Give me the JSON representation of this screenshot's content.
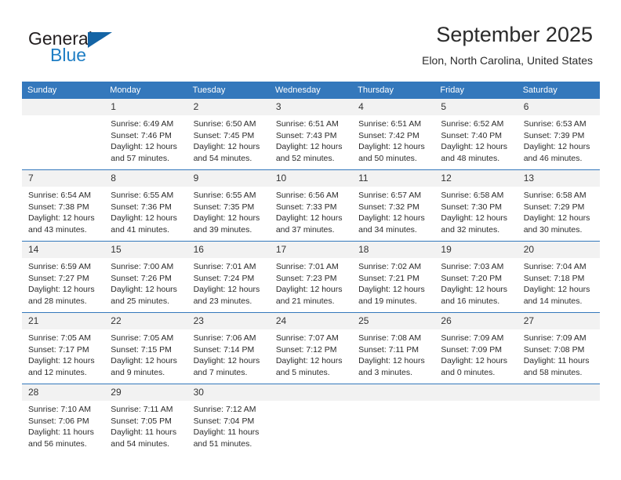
{
  "brand": {
    "name_part1": "General",
    "name_part2": "Blue",
    "triangle_color": "#1464a5",
    "blue_color": "#1f7ec4"
  },
  "header": {
    "month_title": "September 2025",
    "location": "Elon, North Carolina, United States",
    "header_bg_color": "#3478bc",
    "daynum_band_color": "#f2f2f2"
  },
  "calendar": {
    "weekday_headers": [
      "Sunday",
      "Monday",
      "Tuesday",
      "Wednesday",
      "Thursday",
      "Friday",
      "Saturday"
    ],
    "weeks": [
      [
        {
          "day": "",
          "sunrise": "",
          "sunset": "",
          "daylight_line1": "",
          "daylight_line2": "",
          "empty": true
        },
        {
          "day": "1",
          "sunrise": "Sunrise: 6:49 AM",
          "sunset": "Sunset: 7:46 PM",
          "daylight_line1": "Daylight: 12 hours",
          "daylight_line2": "and 57 minutes."
        },
        {
          "day": "2",
          "sunrise": "Sunrise: 6:50 AM",
          "sunset": "Sunset: 7:45 PM",
          "daylight_line1": "Daylight: 12 hours",
          "daylight_line2": "and 54 minutes."
        },
        {
          "day": "3",
          "sunrise": "Sunrise: 6:51 AM",
          "sunset": "Sunset: 7:43 PM",
          "daylight_line1": "Daylight: 12 hours",
          "daylight_line2": "and 52 minutes."
        },
        {
          "day": "4",
          "sunrise": "Sunrise: 6:51 AM",
          "sunset": "Sunset: 7:42 PM",
          "daylight_line1": "Daylight: 12 hours",
          "daylight_line2": "and 50 minutes."
        },
        {
          "day": "5",
          "sunrise": "Sunrise: 6:52 AM",
          "sunset": "Sunset: 7:40 PM",
          "daylight_line1": "Daylight: 12 hours",
          "daylight_line2": "and 48 minutes."
        },
        {
          "day": "6",
          "sunrise": "Sunrise: 6:53 AM",
          "sunset": "Sunset: 7:39 PM",
          "daylight_line1": "Daylight: 12 hours",
          "daylight_line2": "and 46 minutes."
        }
      ],
      [
        {
          "day": "7",
          "sunrise": "Sunrise: 6:54 AM",
          "sunset": "Sunset: 7:38 PM",
          "daylight_line1": "Daylight: 12 hours",
          "daylight_line2": "and 43 minutes."
        },
        {
          "day": "8",
          "sunrise": "Sunrise: 6:55 AM",
          "sunset": "Sunset: 7:36 PM",
          "daylight_line1": "Daylight: 12 hours",
          "daylight_line2": "and 41 minutes."
        },
        {
          "day": "9",
          "sunrise": "Sunrise: 6:55 AM",
          "sunset": "Sunset: 7:35 PM",
          "daylight_line1": "Daylight: 12 hours",
          "daylight_line2": "and 39 minutes."
        },
        {
          "day": "10",
          "sunrise": "Sunrise: 6:56 AM",
          "sunset": "Sunset: 7:33 PM",
          "daylight_line1": "Daylight: 12 hours",
          "daylight_line2": "and 37 minutes."
        },
        {
          "day": "11",
          "sunrise": "Sunrise: 6:57 AM",
          "sunset": "Sunset: 7:32 PM",
          "daylight_line1": "Daylight: 12 hours",
          "daylight_line2": "and 34 minutes."
        },
        {
          "day": "12",
          "sunrise": "Sunrise: 6:58 AM",
          "sunset": "Sunset: 7:30 PM",
          "daylight_line1": "Daylight: 12 hours",
          "daylight_line2": "and 32 minutes."
        },
        {
          "day": "13",
          "sunrise": "Sunrise: 6:58 AM",
          "sunset": "Sunset: 7:29 PM",
          "daylight_line1": "Daylight: 12 hours",
          "daylight_line2": "and 30 minutes."
        }
      ],
      [
        {
          "day": "14",
          "sunrise": "Sunrise: 6:59 AM",
          "sunset": "Sunset: 7:27 PM",
          "daylight_line1": "Daylight: 12 hours",
          "daylight_line2": "and 28 minutes."
        },
        {
          "day": "15",
          "sunrise": "Sunrise: 7:00 AM",
          "sunset": "Sunset: 7:26 PM",
          "daylight_line1": "Daylight: 12 hours",
          "daylight_line2": "and 25 minutes."
        },
        {
          "day": "16",
          "sunrise": "Sunrise: 7:01 AM",
          "sunset": "Sunset: 7:24 PM",
          "daylight_line1": "Daylight: 12 hours",
          "daylight_line2": "and 23 minutes."
        },
        {
          "day": "17",
          "sunrise": "Sunrise: 7:01 AM",
          "sunset": "Sunset: 7:23 PM",
          "daylight_line1": "Daylight: 12 hours",
          "daylight_line2": "and 21 minutes."
        },
        {
          "day": "18",
          "sunrise": "Sunrise: 7:02 AM",
          "sunset": "Sunset: 7:21 PM",
          "daylight_line1": "Daylight: 12 hours",
          "daylight_line2": "and 19 minutes."
        },
        {
          "day": "19",
          "sunrise": "Sunrise: 7:03 AM",
          "sunset": "Sunset: 7:20 PM",
          "daylight_line1": "Daylight: 12 hours",
          "daylight_line2": "and 16 minutes."
        },
        {
          "day": "20",
          "sunrise": "Sunrise: 7:04 AM",
          "sunset": "Sunset: 7:18 PM",
          "daylight_line1": "Daylight: 12 hours",
          "daylight_line2": "and 14 minutes."
        }
      ],
      [
        {
          "day": "21",
          "sunrise": "Sunrise: 7:05 AM",
          "sunset": "Sunset: 7:17 PM",
          "daylight_line1": "Daylight: 12 hours",
          "daylight_line2": "and 12 minutes."
        },
        {
          "day": "22",
          "sunrise": "Sunrise: 7:05 AM",
          "sunset": "Sunset: 7:15 PM",
          "daylight_line1": "Daylight: 12 hours",
          "daylight_line2": "and 9 minutes."
        },
        {
          "day": "23",
          "sunrise": "Sunrise: 7:06 AM",
          "sunset": "Sunset: 7:14 PM",
          "daylight_line1": "Daylight: 12 hours",
          "daylight_line2": "and 7 minutes."
        },
        {
          "day": "24",
          "sunrise": "Sunrise: 7:07 AM",
          "sunset": "Sunset: 7:12 PM",
          "daylight_line1": "Daylight: 12 hours",
          "daylight_line2": "and 5 minutes."
        },
        {
          "day": "25",
          "sunrise": "Sunrise: 7:08 AM",
          "sunset": "Sunset: 7:11 PM",
          "daylight_line1": "Daylight: 12 hours",
          "daylight_line2": "and 3 minutes."
        },
        {
          "day": "26",
          "sunrise": "Sunrise: 7:09 AM",
          "sunset": "Sunset: 7:09 PM",
          "daylight_line1": "Daylight: 12 hours",
          "daylight_line2": "and 0 minutes."
        },
        {
          "day": "27",
          "sunrise": "Sunrise: 7:09 AM",
          "sunset": "Sunset: 7:08 PM",
          "daylight_line1": "Daylight: 11 hours",
          "daylight_line2": "and 58 minutes."
        }
      ],
      [
        {
          "day": "28",
          "sunrise": "Sunrise: 7:10 AM",
          "sunset": "Sunset: 7:06 PM",
          "daylight_line1": "Daylight: 11 hours",
          "daylight_line2": "and 56 minutes."
        },
        {
          "day": "29",
          "sunrise": "Sunrise: 7:11 AM",
          "sunset": "Sunset: 7:05 PM",
          "daylight_line1": "Daylight: 11 hours",
          "daylight_line2": "and 54 minutes."
        },
        {
          "day": "30",
          "sunrise": "Sunrise: 7:12 AM",
          "sunset": "Sunset: 7:04 PM",
          "daylight_line1": "Daylight: 11 hours",
          "daylight_line2": "and 51 minutes."
        },
        {
          "day": "",
          "sunrise": "",
          "sunset": "",
          "daylight_line1": "",
          "daylight_line2": "",
          "empty": true
        },
        {
          "day": "",
          "sunrise": "",
          "sunset": "",
          "daylight_line1": "",
          "daylight_line2": "",
          "empty": true
        },
        {
          "day": "",
          "sunrise": "",
          "sunset": "",
          "daylight_line1": "",
          "daylight_line2": "",
          "empty": true
        },
        {
          "day": "",
          "sunrise": "",
          "sunset": "",
          "daylight_line1": "",
          "daylight_line2": "",
          "empty": true
        }
      ]
    ]
  }
}
